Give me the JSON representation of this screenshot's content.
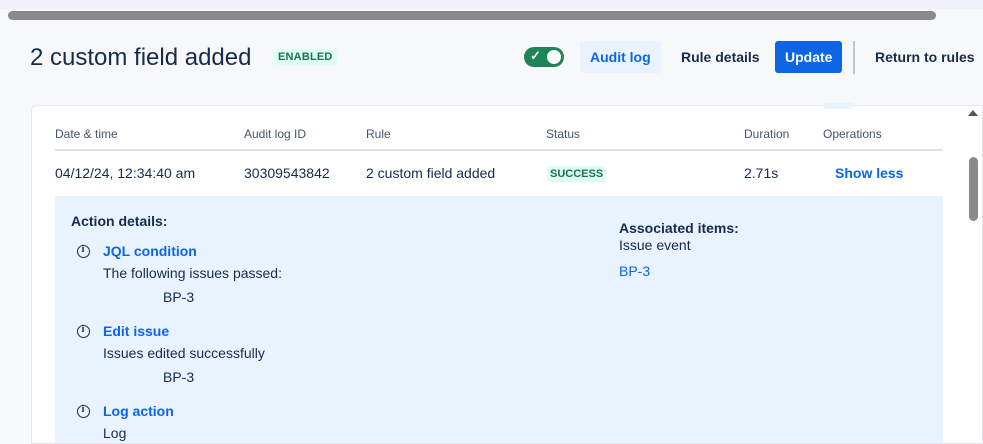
{
  "header": {
    "title": "2 custom field added",
    "status_badge": "ENABLED",
    "toggle_check": "✓",
    "audit_log_label": "Audit log",
    "rule_details_label": "Rule details",
    "update_label": "Update",
    "return_label": "Return to rules"
  },
  "table": {
    "columns": [
      "Date & time",
      "Audit log ID",
      "Rule",
      "Status",
      "Duration",
      "Operations"
    ],
    "row": {
      "datetime": "04/12/24, 12:34:40 am",
      "audit_log_id": "30309543842",
      "rule": "2 custom field added",
      "status": "SUCCESS",
      "duration": "2.71s",
      "operation": "Show less"
    }
  },
  "details": {
    "title": "Action details:",
    "actions": [
      {
        "name": "JQL condition",
        "desc": "The following issues passed:",
        "key": "BP-3"
      },
      {
        "name": "Edit issue",
        "desc": "Issues edited successfully",
        "key": "BP-3"
      },
      {
        "name": "Log action",
        "desc": "Log",
        "key": ""
      }
    ],
    "associated": {
      "title": "Associated items:",
      "subtitle": "Issue event",
      "link": "BP-3"
    }
  },
  "colors": {
    "accent": "#0c66e4",
    "success": "#216e4e",
    "toggle_on": "#1f845a",
    "details_bg": "#e9f2ff"
  }
}
